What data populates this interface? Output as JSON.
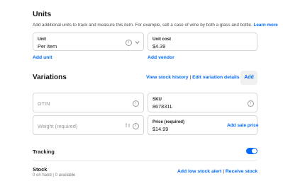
{
  "units": {
    "title": "Units",
    "description": "Add additional units to track and measure this item. For example, sell a case of wine by both a glass and bottle.",
    "learn_more": "Learn more",
    "unit_field": {
      "label": "Unit",
      "value": "Per item"
    },
    "unit_cost_field": {
      "label": "Unit cost",
      "value": "$4.39"
    },
    "add_unit": "Add unit",
    "add_vendor": "Add vendor"
  },
  "variations": {
    "title": "Variations",
    "view_stock_history": "View stock history",
    "separator": "|",
    "edit_variation_details": "Edit variation details",
    "add_button": "Add",
    "gtin": {
      "placeholder": "GTIN"
    },
    "sku": {
      "label": "SKU",
      "value": "867831L"
    },
    "weight": {
      "placeholder": "Weight (required)"
    },
    "price": {
      "label": "Price (required)",
      "value": "$14.99"
    },
    "add_sale_price": "Add sale price"
  },
  "tracking": {
    "label": "Tracking",
    "enabled": true
  },
  "stock": {
    "title": "Stock",
    "summary": "0 on hand | 0 available",
    "add_low_stock_alert": "Add low stock alert",
    "separator": "|",
    "receive_stock": "Receive stock"
  },
  "colors": {
    "accent": "#006aff",
    "border": "#d6d6d6"
  }
}
